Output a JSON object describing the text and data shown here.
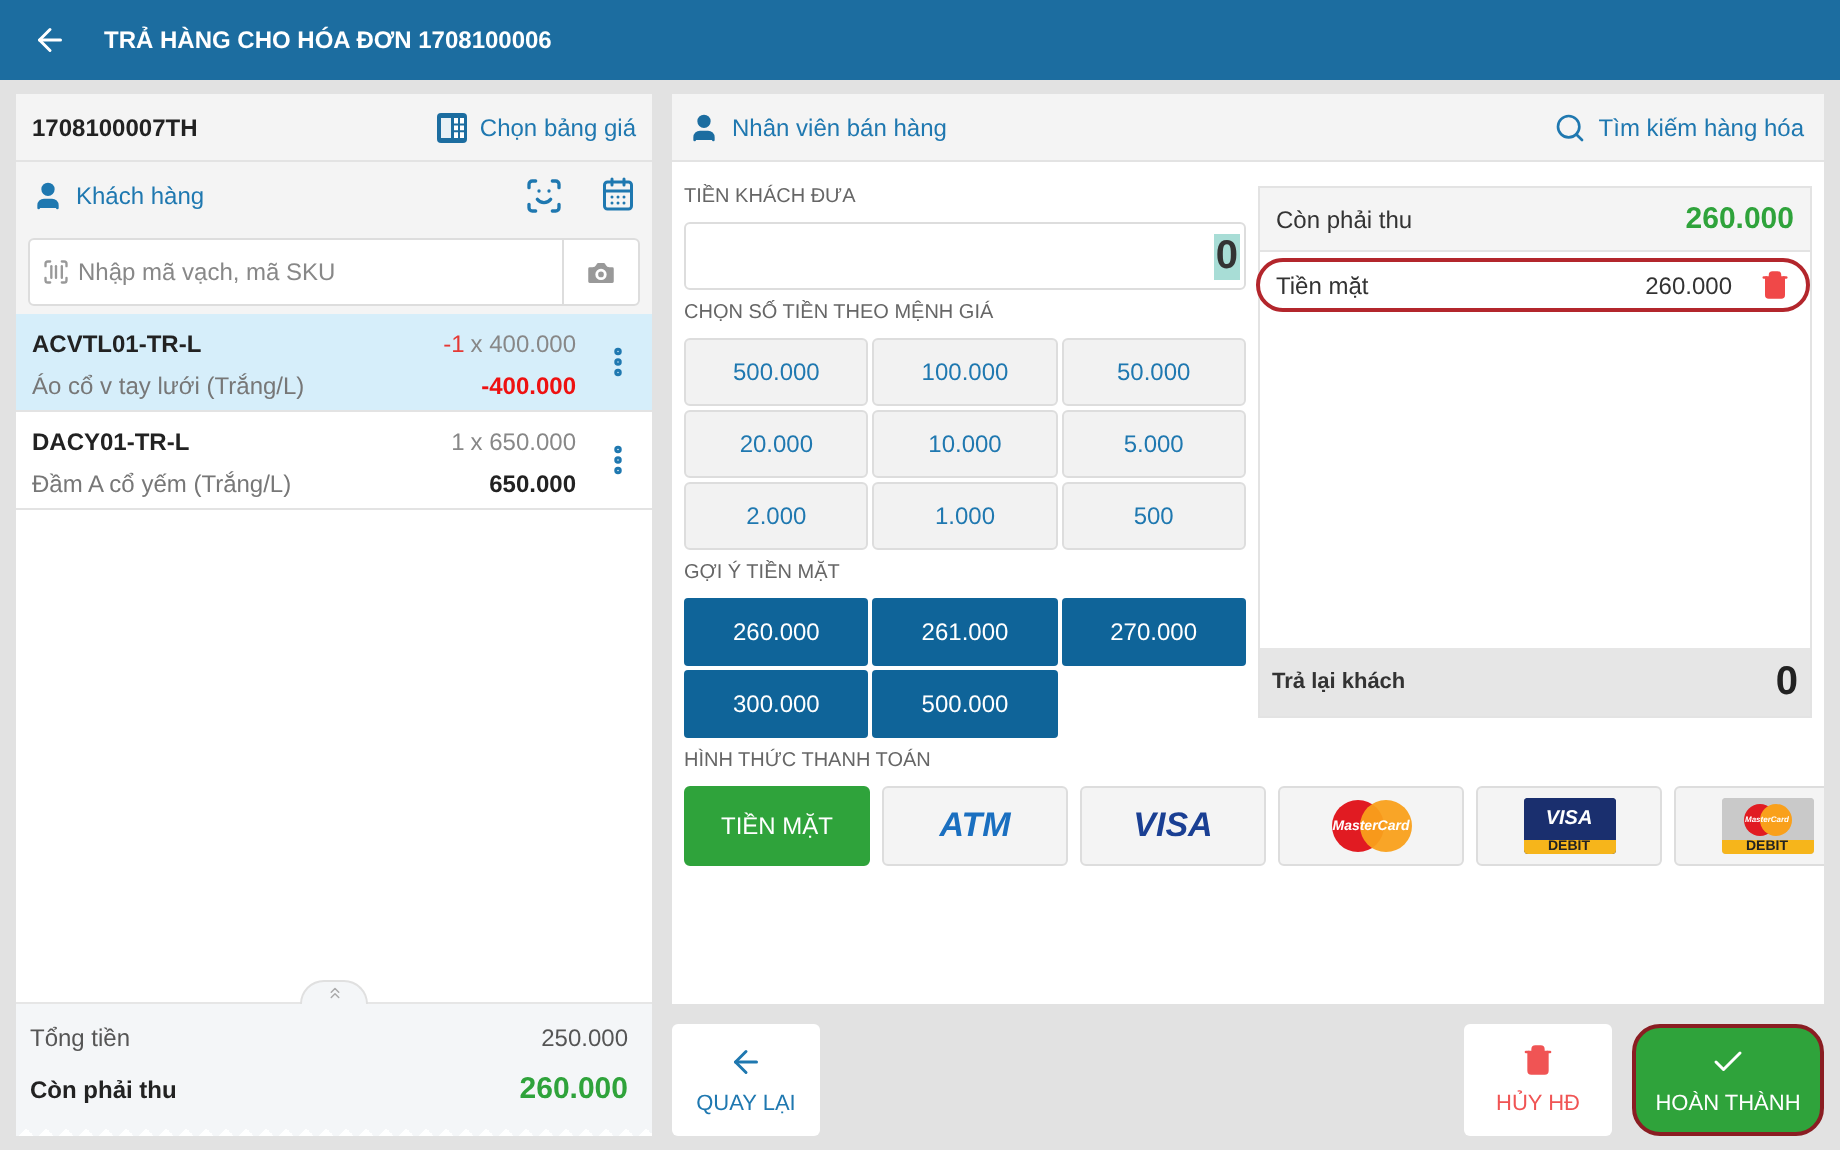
{
  "header": {
    "title": "TRẢ HÀNG CHO HÓA ĐƠN 1708100006"
  },
  "cart": {
    "order_code": "1708100007TH",
    "price_list_label": "Chọn bảng giá",
    "customer_label": "Khách hàng",
    "search": {
      "placeholder": "Nhập mã vạch, mã SKU"
    },
    "items": [
      {
        "code": "ACVTL01-TR-L",
        "name": "Áo cổ v tay lưới (Trắng/L)",
        "qty": "-1",
        "unit_price": "x 400.000",
        "total": "-400.000",
        "returned": true,
        "selected": true
      },
      {
        "code": "DACY01-TR-L",
        "name": "Đầm A cổ yếm (Trắng/L)",
        "qty": "1",
        "unit_price": "x 650.000",
        "total": "650.000",
        "returned": false,
        "selected": false
      }
    ],
    "totals": [
      {
        "kind": "total",
        "label": "Tổng tiền",
        "value": "250.000"
      },
      {
        "kind": "due",
        "label": "Còn phải thu",
        "value": "260.000"
      }
    ]
  },
  "payment": {
    "staff_label": "Nhân viên bán hàng",
    "search_label": "Tìm kiếm hàng hóa",
    "cash_given_label": "TIỀN KHÁCH ĐƯA",
    "cash_given_value": "0",
    "denominations_label": "CHỌN SỐ TIỀN THEO MỆNH GIÁ",
    "denominations": [
      "500.000",
      "100.000",
      "50.000",
      "20.000",
      "10.000",
      "5.000",
      "2.000",
      "1.000",
      "500"
    ],
    "suggestions_label": "GỢI Ý TIỀN MẶT",
    "suggestions": [
      "260.000",
      "261.000",
      "270.000",
      "300.000",
      "500.000"
    ],
    "summary": {
      "due_label": "Còn phải thu",
      "due_value": "260.000",
      "payments": [
        {
          "label": "Tiền mặt",
          "amount": "260.000",
          "highlighted": true
        }
      ],
      "change_label": "Trả lại khách",
      "change_value": "0"
    },
    "methods_label": "HÌNH THỨC THANH TOÁN",
    "methods": [
      {
        "kind": "cash",
        "label": "TIỀN MẶT",
        "selected": true
      },
      {
        "kind": "atm",
        "label": "ATM",
        "selected": false
      },
      {
        "kind": "visa",
        "label": "VISA",
        "selected": false
      },
      {
        "kind": "mastercard",
        "label": "MasterCard",
        "selected": false
      },
      {
        "kind": "visa_debit",
        "label": "VISA",
        "sub": "DEBIT",
        "selected": false
      },
      {
        "kind": "mastercard_debit",
        "label": "MasterCard",
        "sub": "DEBIT",
        "selected": false
      }
    ]
  },
  "actions": {
    "back": "QUAY LẠI",
    "cancel": "HỦY HĐ",
    "complete": {
      "label": "HOÀN THÀNH",
      "highlighted": true
    }
  }
}
